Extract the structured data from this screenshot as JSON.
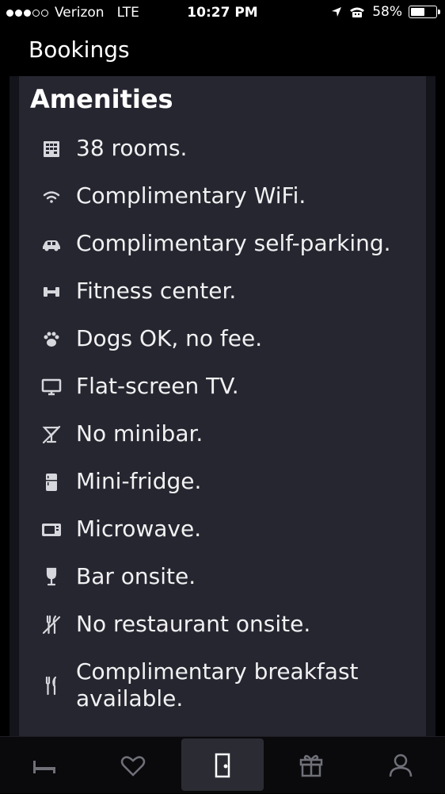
{
  "status_bar": {
    "carrier": "Verizon",
    "network": "LTE",
    "time": "10:27 PM",
    "battery": "58%",
    "battery_level": 0.58,
    "signal_bars_filled": 3,
    "signal_bars_total": 5
  },
  "nav": {
    "title": "Bookings"
  },
  "section": {
    "title": "Amenities"
  },
  "amenities": [
    {
      "icon": "building-icon",
      "label": "38 rooms."
    },
    {
      "icon": "wifi-icon",
      "label": "Complimentary WiFi."
    },
    {
      "icon": "car-icon",
      "label": "Complimentary self-parking."
    },
    {
      "icon": "dumbbell-icon",
      "label": "Fitness center."
    },
    {
      "icon": "paw-icon",
      "label": "Dogs OK, no fee."
    },
    {
      "icon": "tv-icon",
      "label": "Flat-screen TV."
    },
    {
      "icon": "no-cocktail-icon",
      "label": "No minibar."
    },
    {
      "icon": "fridge-icon",
      "label": "Mini-fridge."
    },
    {
      "icon": "microwave-icon",
      "label": "Microwave."
    },
    {
      "icon": "wine-glass-icon",
      "label": "Bar onsite."
    },
    {
      "icon": "no-restaurant-icon",
      "label": "No restaurant onsite."
    },
    {
      "icon": "fork-knife-icon",
      "label": "Complimentary breakfast available."
    }
  ],
  "tabs": [
    {
      "icon": "bed-icon",
      "active": false
    },
    {
      "icon": "heart-icon",
      "active": false
    },
    {
      "icon": "door-icon",
      "active": true
    },
    {
      "icon": "gift-icon",
      "active": false
    },
    {
      "icon": "person-icon",
      "active": false
    }
  ],
  "colors": {
    "content_bg": "#25262f",
    "tab_active_bg": "#2b2c33",
    "icon_color": "#d6d7dc"
  }
}
